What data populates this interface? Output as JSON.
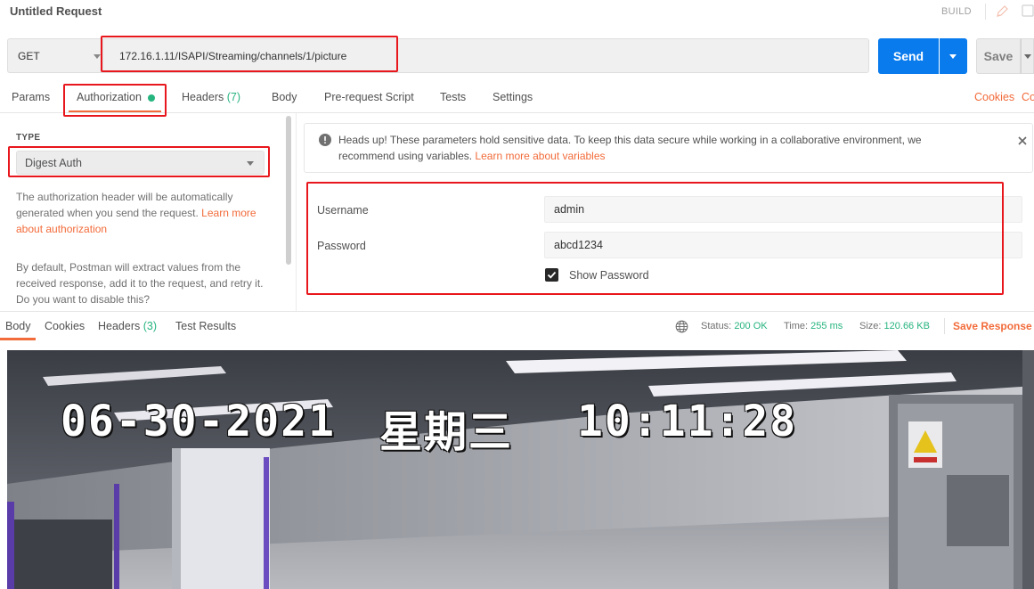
{
  "window": {
    "title": "Untitled Request",
    "build_label": "BUILD"
  },
  "request": {
    "method": "GET",
    "url": "172.16.1.11/ISAPI/Streaming/channels/1/picture",
    "send_label": "Send",
    "save_label": "Save"
  },
  "request_tabs": {
    "params": "Params",
    "authorization": "Authorization",
    "headers": "Headers",
    "headers_count": "(7)",
    "body": "Body",
    "prerequest": "Pre-request Script",
    "tests": "Tests",
    "settings": "Settings",
    "cookies": "Cookies",
    "code": "Co"
  },
  "auth": {
    "type_label": "TYPE",
    "type_value": "Digest Auth",
    "description": "The authorization header will be automatically generated when you send the request.",
    "description_link": "Learn more about authorization",
    "retry_note": "By default, Postman will extract values from the received response, add it to the request, and retry it. Do you want to disable this?"
  },
  "notice": {
    "text": "Heads up! These parameters hold sensitive data. To keep this data secure while working in a collaborative environment, we recommend using variables.",
    "link": "Learn more about variables"
  },
  "credentials": {
    "username_label": "Username",
    "username_value": "admin",
    "password_label": "Password",
    "password_value": "abcd1234",
    "show_password_label": "Show Password",
    "show_password_checked": true
  },
  "response_tabs": {
    "body": "Body",
    "cookies": "Cookies",
    "headers": "Headers",
    "headers_count": "(3)",
    "test_results": "Test Results"
  },
  "response_meta": {
    "status_label": "Status:",
    "status_value": "200 OK",
    "time_label": "Time:",
    "time_value": "255 ms",
    "size_label": "Size:",
    "size_value": "120.66 KB",
    "save_response": "Save Response"
  },
  "camera_overlay": {
    "date": "06-30-2021",
    "weekday": "星期三",
    "time": "10:11:28"
  },
  "colors": {
    "accent_orange": "#f26b3a",
    "send_blue": "#097bed",
    "status_green": "#26b47f",
    "highlight_red": "#e8171d"
  }
}
